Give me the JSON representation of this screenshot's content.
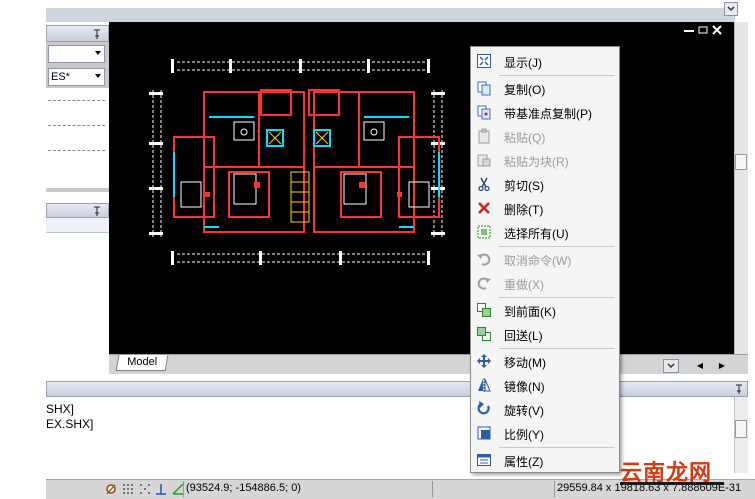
{
  "left_panel": {
    "combo2_value": "ES*"
  },
  "layout_tab": {
    "model_label": "Model"
  },
  "command_window": {
    "line1": "SHX]",
    "line2": "EX.SHX]"
  },
  "status_bar": {
    "coords": "(93524.9; -154886.5; 0)",
    "drawing_size": "29559.84 x 19818.63 x 7.888609E-31"
  },
  "context_menu": {
    "items": [
      {
        "label": "显示(J)",
        "icon": "zoom-extents-icon",
        "enabled": true
      },
      {
        "label": "复制(O)",
        "icon": "copy-icon",
        "enabled": true
      },
      {
        "label": "带基准点复制(P)",
        "icon": "copy-with-base-icon",
        "enabled": true
      },
      {
        "label": "粘贴(Q)",
        "icon": "paste-icon",
        "enabled": false
      },
      {
        "label": "粘贴为块(R)",
        "icon": "paste-block-icon",
        "enabled": false
      },
      {
        "label": "剪切(S)",
        "icon": "scissors-icon",
        "enabled": true
      },
      {
        "label": "删除(T)",
        "icon": "delete-x-icon",
        "enabled": true
      },
      {
        "label": "选择所有(U)",
        "icon": "select-all-icon",
        "enabled": true
      },
      {
        "label": "取消命令(W)",
        "icon": "undo-icon",
        "enabled": false
      },
      {
        "label": "重做(X)",
        "icon": "redo-icon",
        "enabled": false
      },
      {
        "label": "到前面(K)",
        "icon": "bring-front-icon",
        "enabled": true
      },
      {
        "label": "回送(L)",
        "icon": "send-back-icon",
        "enabled": true
      },
      {
        "label": "移动(M)",
        "icon": "move-icon",
        "enabled": true
      },
      {
        "label": "镜像(N)",
        "icon": "mirror-icon",
        "enabled": true
      },
      {
        "label": "旋转(V)",
        "icon": "rotate-icon",
        "enabled": true
      },
      {
        "label": "比例(Y)",
        "icon": "scale-icon",
        "enabled": true
      },
      {
        "label": "属性(Z)",
        "icon": "properties-icon",
        "enabled": true
      }
    ]
  },
  "watermark": {
    "text": "云南龙网"
  },
  "colors": {
    "canvas_bg": "#000000",
    "wall_red": "#ff3030",
    "window_cyan": "#00e0ff",
    "dim_white": "#ffffff",
    "stair_yellow": "#ffd400",
    "menu_bg": "#f5f5f5",
    "disabled_text": "#9b9b9b"
  }
}
